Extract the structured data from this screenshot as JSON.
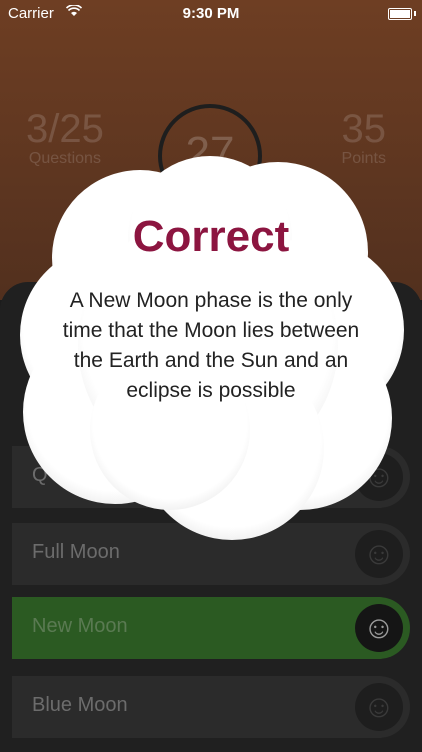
{
  "status_bar": {
    "carrier": "Carrier",
    "time": "9:30 PM"
  },
  "stats": {
    "questions_value": "3/25",
    "questions_label": "Questions",
    "timer_value": "27",
    "points_value": "35",
    "points_label": "Points"
  },
  "answers": [
    {
      "label": "Q",
      "state": "normal"
    },
    {
      "label": "Full Moon",
      "state": "normal"
    },
    {
      "label": "New Moon",
      "state": "correct"
    },
    {
      "label": "Blue Moon",
      "state": "normal"
    }
  ],
  "popup": {
    "title": "Correct",
    "message": "A New Moon phase is the only time that the Moon lies between the Earth and the Sun and an eclipse is possible"
  },
  "colors": {
    "header_brown": "#6e3e23",
    "title_maroon": "#8c1540",
    "correct_green": "#2b5a22"
  },
  "icons": {
    "wifi": "wifi-icon",
    "battery": "battery-icon",
    "smiley": "smiley-face-icon"
  }
}
